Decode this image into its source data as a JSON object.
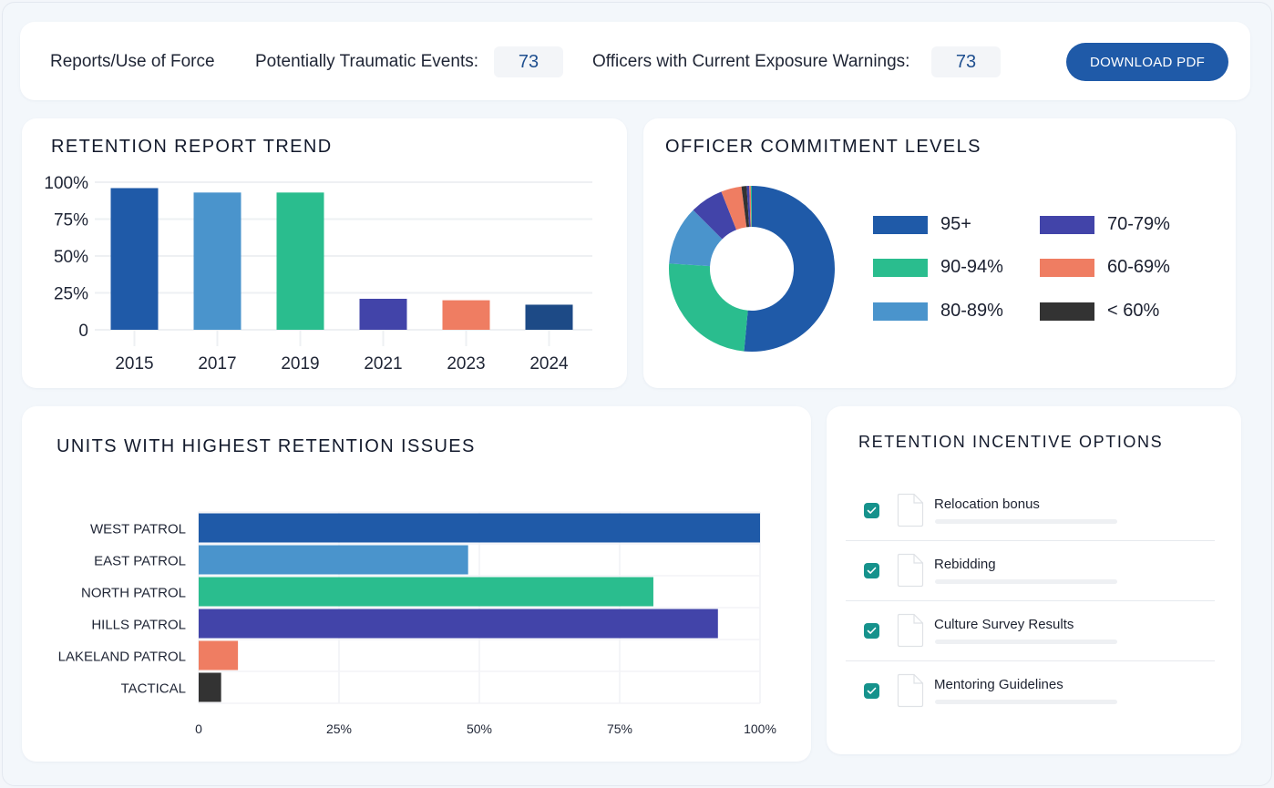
{
  "topbar": {
    "reports_label": "Reports/Use of Force",
    "pte_label": "Potentially Traumatic Events:",
    "pte_value": "73",
    "exposure_label": "Officers with Current Exposure Warnings:",
    "exposure_value": "73",
    "download_label": "DOWNLOAD PDF"
  },
  "colors": {
    "primary": "#1f5aa8",
    "light_blue": "#4a94cc",
    "green": "#2abd8e",
    "purple": "#4244a9",
    "coral": "#ef7d62",
    "navy": "#1d4a86",
    "dark": "#333333",
    "teal_check": "#16928c"
  },
  "chart_data": [
    {
      "type": "bar",
      "title": "RETENTION REPORT TREND",
      "categories": [
        "2015",
        "2017",
        "2019",
        "2021",
        "2023",
        "2024"
      ],
      "values": [
        96,
        93,
        93,
        21,
        20,
        17
      ],
      "bar_colors": [
        "#1f5aa8",
        "#4a94cc",
        "#2abd8e",
        "#4244a9",
        "#ef7d62",
        "#1d4a86"
      ],
      "ylim": [
        0,
        100
      ],
      "yticks": [
        "0",
        "25%",
        "50%",
        "75%",
        "100%"
      ],
      "ytick_values": [
        0,
        25,
        50,
        75,
        100
      ],
      "xlabel": "",
      "ylabel": "",
      "grid": true,
      "legend": "none"
    },
    {
      "type": "pie",
      "title": "OFFICER COMMITMENT LEVELS",
      "donut": true,
      "labels": [
        "95+",
        "90-94%",
        "80-89%",
        "70-79%",
        "60-69%",
        "< 60%"
      ],
      "values": [
        51.5,
        24.5,
        11.5,
        6.5,
        4,
        1
      ],
      "extra_slivers": [
        {
          "label": "",
          "value": 0.5,
          "color": "#4244a9"
        },
        {
          "label": "",
          "value": 0.3,
          "color": "#ef7d62"
        },
        {
          "label": "",
          "value": 0.2,
          "color": "#2abd8e"
        }
      ],
      "colors": [
        "#1f5aa8",
        "#2abd8e",
        "#4a94cc",
        "#4244a9",
        "#ef7d62",
        "#333333"
      ],
      "legend": "right",
      "legend_order": [
        {
          "label": "95+",
          "color": "#1f5aa8"
        },
        {
          "label": "90-94%",
          "color": "#2abd8e"
        },
        {
          "label": "80-89%",
          "color": "#4a94cc"
        },
        {
          "label": "70-79%",
          "color": "#4244a9"
        },
        {
          "label": "60-69%",
          "color": "#ef7d62"
        },
        {
          "label": "< 60%",
          "color": "#333333"
        }
      ]
    },
    {
      "type": "bar",
      "orientation": "horizontal",
      "title": "UNITS WITH HIGHEST RETENTION ISSUES",
      "categories": [
        "WEST PATROL",
        "EAST PATROL",
        "NORTH PATROL",
        "HILLS PATROL",
        "LAKELAND PATROL",
        "TACTICAL"
      ],
      "values": [
        100,
        48,
        81,
        92.5,
        7,
        4
      ],
      "bar_colors": [
        "#1f5aa8",
        "#4a94cc",
        "#2abd8e",
        "#4244a9",
        "#ef7d62",
        "#333333"
      ],
      "xlim": [
        0,
        100
      ],
      "xticks": [
        "0",
        "25%",
        "50%",
        "75%",
        "100%"
      ],
      "xtick_values": [
        0,
        25,
        50,
        75,
        100
      ],
      "xlabel": "",
      "ylabel": "",
      "grid": true,
      "legend": "none"
    }
  ],
  "incentives": {
    "title": "RETENTION INCENTIVE OPTIONS",
    "items": [
      {
        "label": "Relocation bonus",
        "checked": true
      },
      {
        "label": "Rebidding",
        "checked": true
      },
      {
        "label": "Culture Survey Results",
        "checked": true
      },
      {
        "label": "Mentoring Guidelines",
        "checked": true
      }
    ]
  }
}
